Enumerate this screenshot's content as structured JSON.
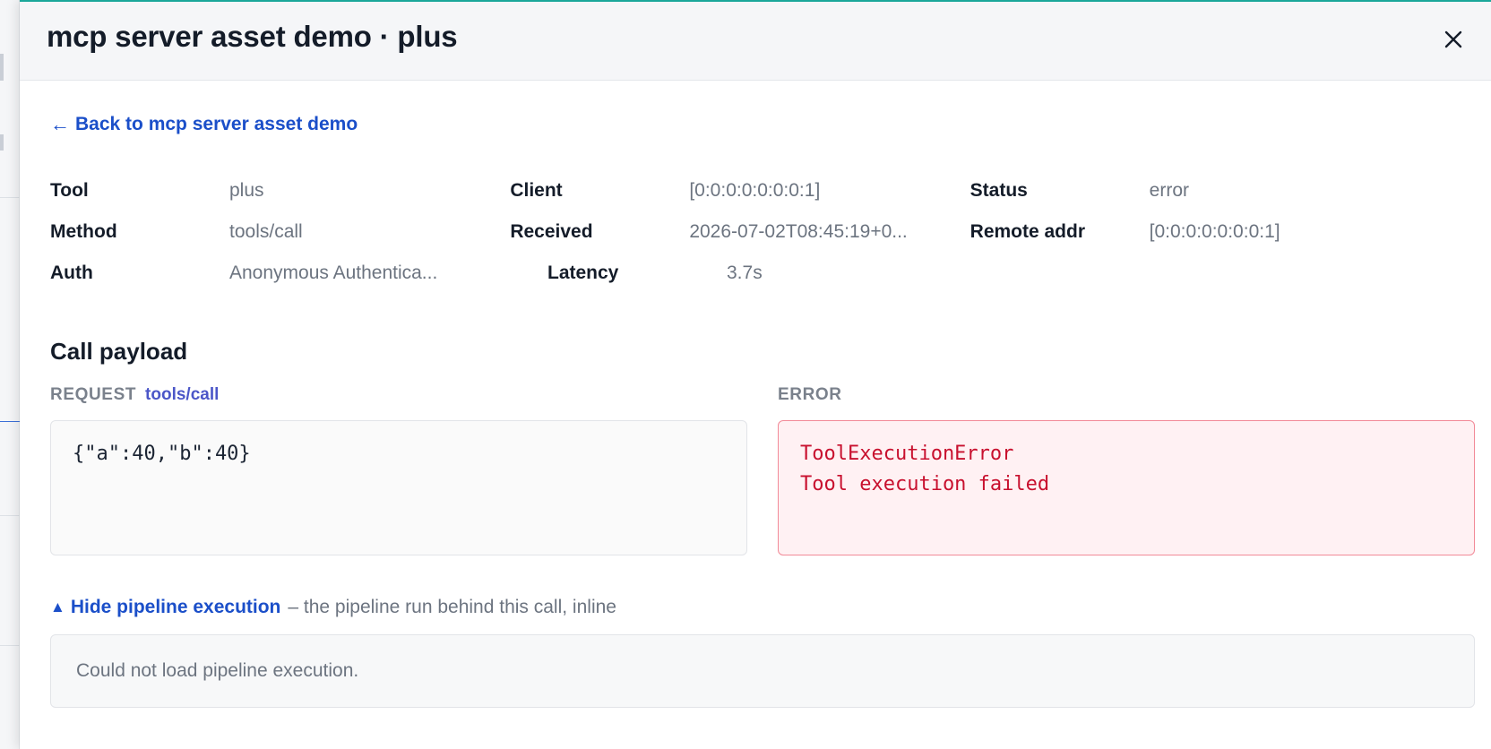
{
  "panel": {
    "title": "mcp server asset demo · plus"
  },
  "back_link": {
    "arrow": "←",
    "label": "Back to mcp server asset demo"
  },
  "meta": {
    "rows": [
      [
        {
          "label": "Tool",
          "value": "plus"
        },
        {
          "label": "Client",
          "value": "[0:0:0:0:0:0:0:1]"
        },
        {
          "label": "Status",
          "value": "error"
        }
      ],
      [
        {
          "label": "Method",
          "value": "tools/call"
        },
        {
          "label": "Received",
          "value": "2026-07-02T08:45:19+0..."
        },
        {
          "label": "Remote addr",
          "value": "[0:0:0:0:0:0:0:1]"
        }
      ],
      [
        {
          "label": "Auth",
          "value": "Anonymous Authentica..."
        },
        {
          "label": "Latency",
          "value": "3.7s"
        }
      ]
    ]
  },
  "payload": {
    "title": "Call payload",
    "request_label": "REQUEST",
    "request_method": "tools/call",
    "request_body": "{\"a\":40,\"b\":40}",
    "error_label": "ERROR",
    "error_line1": "ToolExecutionError",
    "error_line2": "Tool execution failed"
  },
  "pipeline": {
    "toggle_icon": "▲",
    "toggle_label": "Hide pipeline execution",
    "description": "– the pipeline run behind this call, inline",
    "message": "Could not load pipeline execution."
  },
  "colors": {
    "accent_link": "#1b4fc9",
    "error_text": "#c8102e",
    "error_border": "#f28a98",
    "top_border": "#1aa79a"
  }
}
